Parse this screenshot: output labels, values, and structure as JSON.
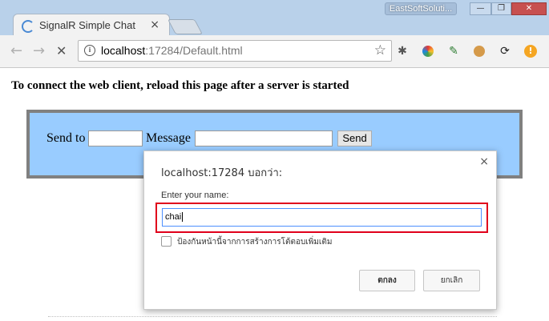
{
  "browser": {
    "tab_title": "SignalR Simple Chat",
    "tab_close": "×",
    "profile_name": "EastSoftSoluti...",
    "url_host": "localhost",
    "url_path": ":17284/Default.html",
    "window_controls": {
      "minimize": "—",
      "restore": "❐",
      "close": "✕"
    },
    "nav": {
      "back": "←",
      "forward": "→",
      "stop": "✕"
    },
    "extensions": [
      "bug-icon",
      "color-wheel-icon",
      "pen-icon",
      "cookie-icon",
      "refresh-icon",
      "warning-icon"
    ]
  },
  "page": {
    "heading": "To connect the web client, reload this page after a server is started",
    "send_to_label": "Send to",
    "message_label": "Message",
    "send_button": "Send"
  },
  "dialog": {
    "title": "localhost:17284 บอกว่า:",
    "close": "×",
    "prompt": "Enter your name:",
    "input_value": "chai",
    "checkbox_label": "ป้องกันหน้านี้จากการสร้างการโต้ตอบเพิ่มเติม",
    "ok_button": "ตกลง",
    "cancel_button": "ยกเลิก",
    "highlight_color": "#e0001b"
  }
}
